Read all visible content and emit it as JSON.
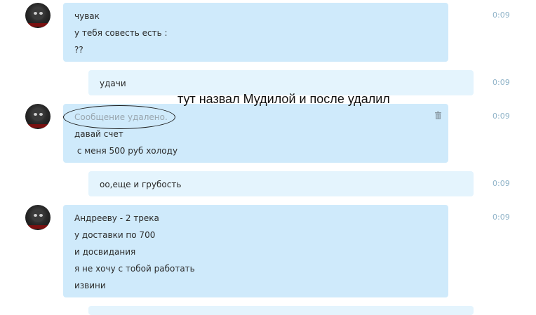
{
  "messages": [
    {
      "lines": [
        "чувак",
        "у тебя совесть есть :",
        "??"
      ],
      "time": "0:09"
    },
    {
      "lines": [
        "удачи"
      ],
      "time": "0:09"
    },
    {
      "deleted_label": "Сообщение удалено.",
      "lines": [
        "давай счет",
        " с меня 500 руб холоду"
      ],
      "time": "0:09"
    },
    {
      "lines": [
        "оо,еще и грубость"
      ],
      "time": "0:09"
    },
    {
      "lines": [
        "Андрееву - 2 трека",
        "у доставки по 700",
        "и досвидания",
        "я не хочу с тобой работать",
        "извини"
      ],
      "time": "0:09"
    }
  ],
  "annotation": {
    "text": "тут назвал Мудилой и после удалил"
  },
  "icons": {
    "avatar": "user-avatar-icon",
    "trash": "trash-icon"
  },
  "colors": {
    "incoming_bubble": "#cfeafb",
    "outgoing_bubble": "#e4f4fd",
    "timestamp": "#8fb3c8"
  }
}
